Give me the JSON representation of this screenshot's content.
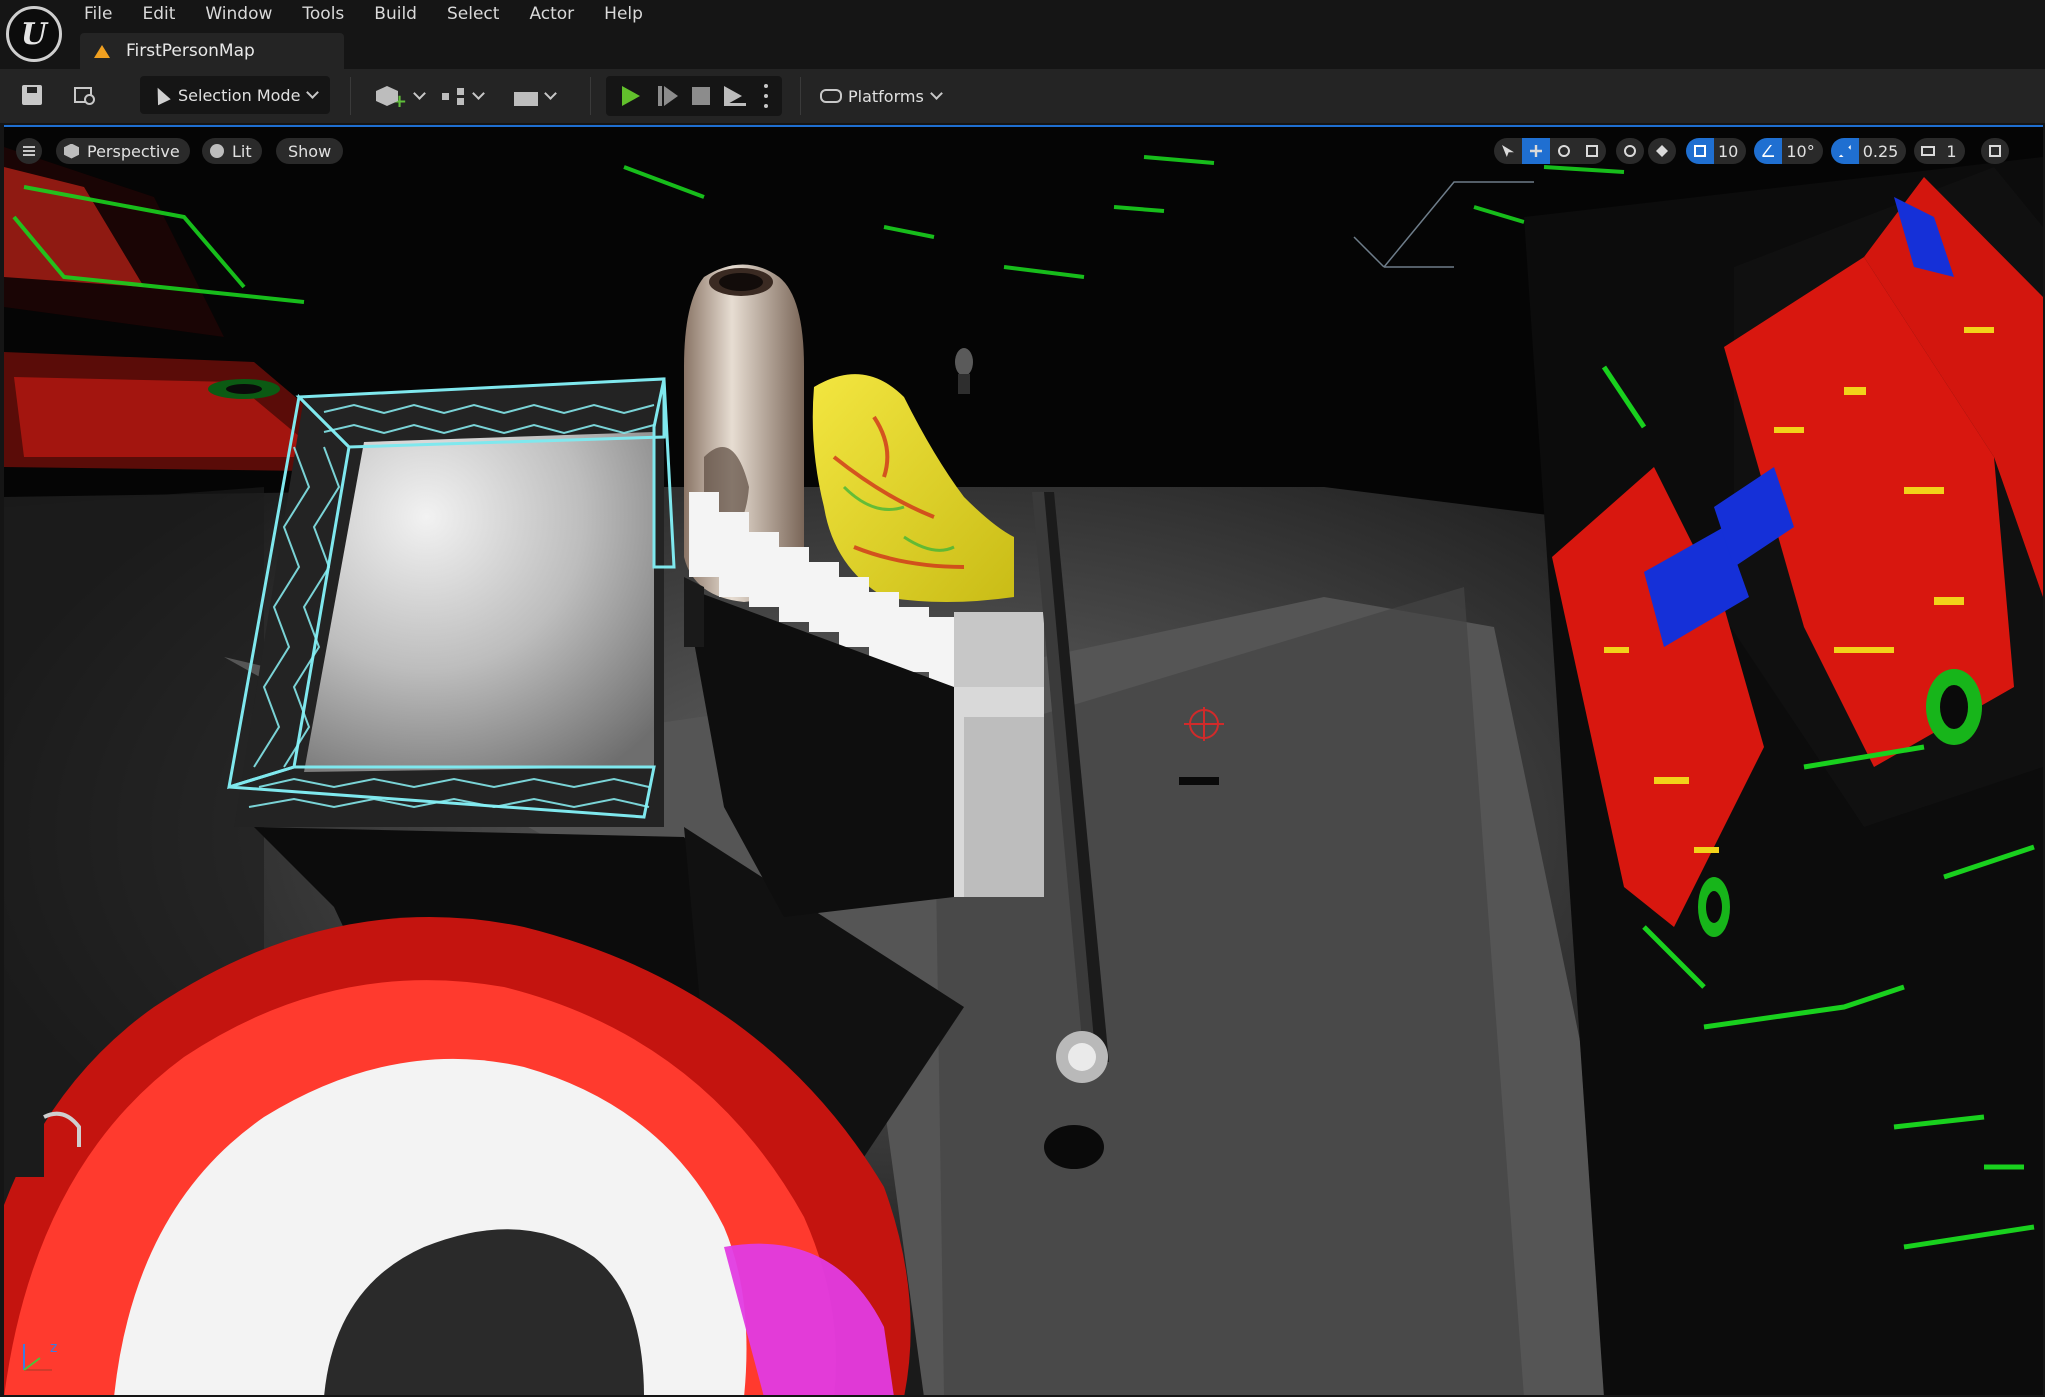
{
  "menu": {
    "items": [
      "File",
      "Edit",
      "Window",
      "Tools",
      "Build",
      "Select",
      "Actor",
      "Help"
    ]
  },
  "document_tab": {
    "label": "FirstPersonMap",
    "icon": "warning-icon"
  },
  "toolbar": {
    "selection_mode": "Selection Mode",
    "platforms": "Platforms",
    "icons": [
      "save-icon",
      "content-browser-icon",
      "add-actor-icon",
      "blueprint-icon",
      "cinematics-icon",
      "play-icon",
      "step-icon",
      "stop-icon",
      "eject-icon",
      "more-options-icon"
    ],
    "play_color": "#62c02c"
  },
  "viewport": {
    "view_mode": "Perspective",
    "lighting": "Lit",
    "show": "Show",
    "grid_snap": "10",
    "rotation_snap": "10°",
    "scale_snap": "0.25",
    "camera_speed": "1",
    "accent_color": "#1f6fd1",
    "axis_label": "z",
    "scene_objects": [
      "hexagon-framed-box",
      "ceramic-vase",
      "yellow-banana-shape",
      "white-staircase",
      "red-white-torus",
      "red-green-textured-wall",
      "spherical-pickup",
      "target-gizmo"
    ]
  }
}
